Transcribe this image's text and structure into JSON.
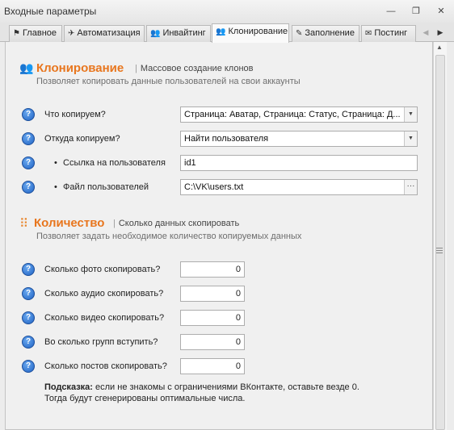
{
  "window": {
    "title": "Входные параметры",
    "minimize": "—",
    "restore": "❐",
    "close": "✕"
  },
  "tabs": [
    {
      "label": "Главное",
      "icon": "⚑",
      "icon_name": "flag-icon"
    },
    {
      "label": "Автоматизация",
      "icon": "✈",
      "icon_name": "plane-icon"
    },
    {
      "label": "Инвайтинг",
      "icon": "👥",
      "icon_name": "users-icon"
    },
    {
      "label": "Клонирование",
      "icon": "👥",
      "icon_name": "users-icon",
      "active": true
    },
    {
      "label": "Заполнение",
      "icon": "✎",
      "icon_name": "pencil-icon"
    },
    {
      "label": "Постинг",
      "icon": "✉",
      "icon_name": "envelope-icon"
    }
  ],
  "tab_arrows": {
    "left": "◀",
    "right": "▶"
  },
  "scrollbar": {
    "up": "▲"
  },
  "cloning": {
    "icon": "👥",
    "title": "Клонирование",
    "subtitle": "Массовое создание клонов",
    "description": "Позволяет копировать данные пользователей на свои аккаунты",
    "separator": "|"
  },
  "fields": {
    "what_copy": {
      "label": "Что копируем?",
      "value": "Страница: Аватар, Страница: Статус, Страница: Д..."
    },
    "source": {
      "label": "Откуда копируем?",
      "value": "Найти пользователя"
    },
    "user_link": {
      "label": "Ссылка на пользователя",
      "value": "id1"
    },
    "user_file": {
      "label": "Файл пользователей",
      "value": "C:\\VK\\users.txt",
      "button": "···"
    }
  },
  "quantity": {
    "icon": "⠿",
    "title": "Количество",
    "subtitle": "Сколько данных скопировать",
    "description": "Позволяет задать необходимое количество копируемых данных",
    "separator": "|"
  },
  "counts": [
    {
      "label": "Сколько фото скопировать?",
      "value": "0"
    },
    {
      "label": "Сколько аудио скопировать?",
      "value": "0"
    },
    {
      "label": "Сколько видео скопировать?",
      "value": "0"
    },
    {
      "label": "Во сколько групп вступить?",
      "value": "0"
    },
    {
      "label": "Сколько постов скопировать?",
      "value": "0"
    }
  ],
  "hint": {
    "prefix": "Подсказка:",
    "line1": " если не знакомы с ограничениями ВКонтакте, оставьте везде 0.",
    "line2": "Тогда будут сгенерированы оптимальные числа."
  },
  "help_glyph": "?",
  "bullet_glyph": "•",
  "dropdown_glyph": "▼"
}
